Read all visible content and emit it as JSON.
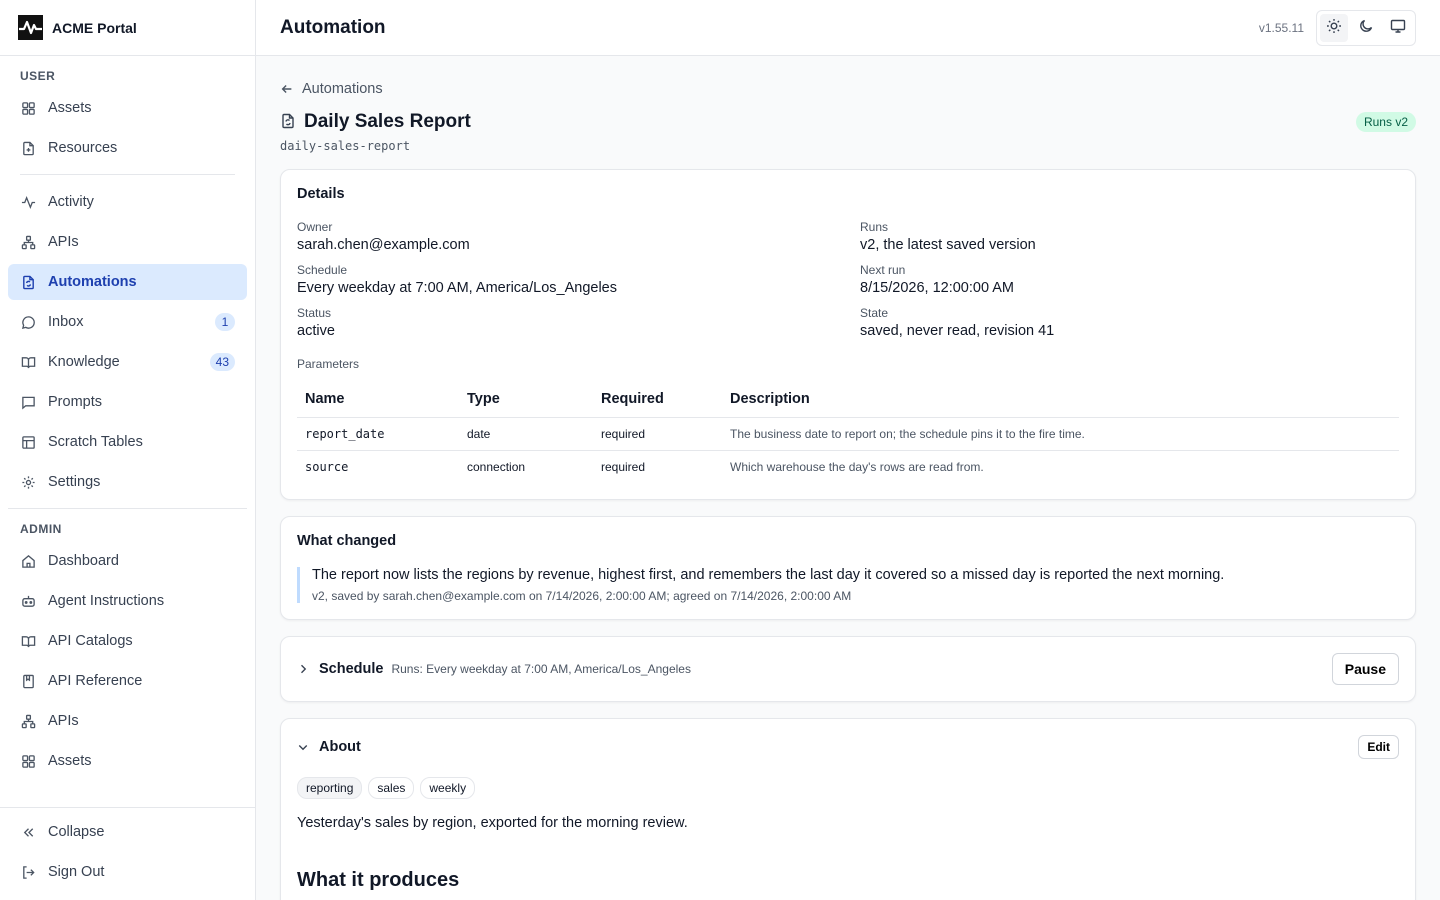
{
  "brand": {
    "name": "ACME Portal"
  },
  "sidebar": {
    "user_label": "USER",
    "admin_label": "ADMIN",
    "user_items": [
      {
        "label": "Assets",
        "icon": "grid-icon"
      },
      {
        "label": "Resources",
        "icon": "file-plus-icon"
      }
    ],
    "main_items": [
      {
        "label": "Activity",
        "icon": "activity-icon"
      },
      {
        "label": "APIs",
        "icon": "network-icon"
      },
      {
        "label": "Automations",
        "icon": "file-automation-icon",
        "active": true
      },
      {
        "label": "Inbox",
        "icon": "chat-icon",
        "badge": "1"
      },
      {
        "label": "Knowledge",
        "icon": "book-icon",
        "badge": "43"
      },
      {
        "label": "Prompts",
        "icon": "message-square-icon"
      },
      {
        "label": "Scratch Tables",
        "icon": "table-icon"
      },
      {
        "label": "Settings",
        "icon": "gear-icon"
      }
    ],
    "admin_items": [
      {
        "label": "Dashboard",
        "icon": "home-icon"
      },
      {
        "label": "Agent Instructions",
        "icon": "bot-icon"
      },
      {
        "label": "API Catalogs",
        "icon": "book-open-icon"
      },
      {
        "label": "API Reference",
        "icon": "book-bookmark-icon"
      },
      {
        "label": "APIs",
        "icon": "network-icon"
      },
      {
        "label": "Assets",
        "icon": "grid-icon"
      }
    ],
    "footer": {
      "collapse": "Collapse",
      "sign_out": "Sign Out"
    }
  },
  "topbar": {
    "title": "Automation",
    "version": "v1.55.11"
  },
  "page": {
    "back_label": "Automations",
    "title": "Daily Sales Report",
    "slug": "daily-sales-report",
    "runs_badge": "Runs v2"
  },
  "details": {
    "heading": "Details",
    "owner_label": "Owner",
    "owner": "sarah.chen@example.com",
    "runs_label": "Runs",
    "runs": "v2, the latest saved version",
    "schedule_label": "Schedule",
    "schedule": "Every weekday at 7:00 AM, America/Los_Angeles",
    "next_run_label": "Next run",
    "next_run": "8/15/2026, 12:00:00 AM",
    "status_label": "Status",
    "status": "active",
    "state_label": "State",
    "state": "saved, never read, revision 41",
    "parameters_label": "Parameters",
    "columns": [
      "Name",
      "Type",
      "Required",
      "Description"
    ],
    "params": [
      {
        "name": "report_date",
        "type": "date",
        "required": "required",
        "description": "The business date to report on; the schedule pins it to the fire time."
      },
      {
        "name": "source",
        "type": "connection",
        "required": "required",
        "description": "Which warehouse the day's rows are read from."
      }
    ]
  },
  "changes": {
    "heading": "What changed",
    "body": "The report now lists the regions by revenue, highest first, and remembers the last day it covered so a missed day is reported the next morning.",
    "meta": "v2, saved by sarah.chen@example.com on 7/14/2026, 2:00:00 AM; agreed on 7/14/2026, 2:00:00 AM"
  },
  "schedule_card": {
    "heading": "Schedule",
    "summary": "Runs: Every weekday at 7:00 AM, America/Los_Angeles",
    "pause_label": "Pause"
  },
  "about": {
    "heading": "About",
    "edit_label": "Edit",
    "tags": [
      "reporting",
      "sales",
      "weekly"
    ],
    "text": "Yesterday's sales by region, exported for the morning review.",
    "produces_heading": "What it produces"
  },
  "colors": {
    "accent": "#1e40af",
    "active_bg": "#dbeafe",
    "success_bg": "#d1fae5",
    "success_fg": "#065f46"
  }
}
